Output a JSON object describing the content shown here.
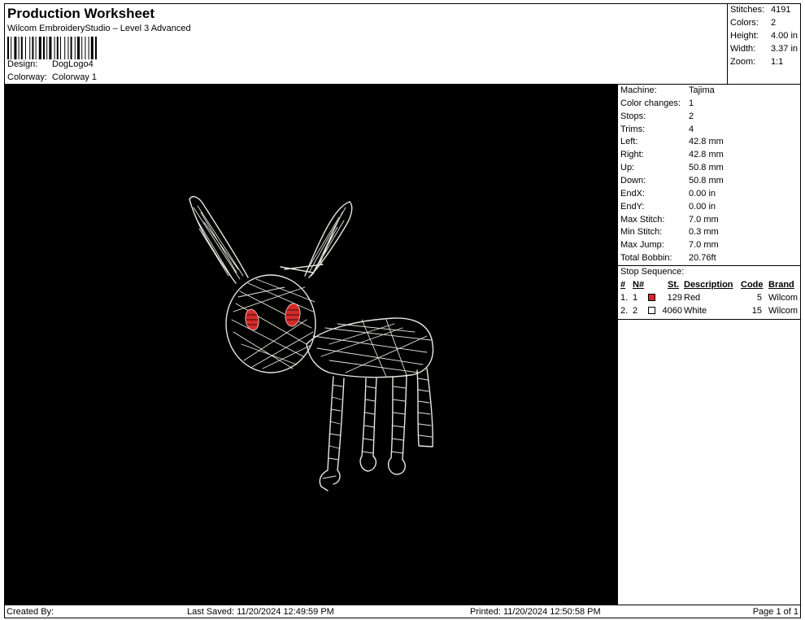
{
  "header": {
    "title": "Production Worksheet",
    "subtitle": "Wilcom EmbroideryStudio – Level 3 Advanced",
    "design_label": "Design:",
    "design_value": "DogLogo4",
    "colorway_label": "Colorway:",
    "colorway_value": "Colorway 1"
  },
  "summary": [
    {
      "label": "Stitches:",
      "value": "4191"
    },
    {
      "label": "Colors:",
      "value": "2"
    },
    {
      "label": "Height:",
      "value": "4.00 in"
    },
    {
      "label": "Width:",
      "value": "3.37 in"
    },
    {
      "label": "Zoom:",
      "value": "1:1"
    }
  ],
  "info": [
    {
      "label": "Machine:",
      "value": "Tajima"
    },
    {
      "label": "Color changes:",
      "value": "1"
    },
    {
      "label": "Stops:",
      "value": "2"
    },
    {
      "label": "Trims:",
      "value": "4"
    },
    {
      "label": "Left:",
      "value": "42.8 mm"
    },
    {
      "label": "Right:",
      "value": "42.8 mm"
    },
    {
      "label": "Up:",
      "value": "50.8 mm"
    },
    {
      "label": "Down:",
      "value": "50.8 mm"
    },
    {
      "label": "EndX:",
      "value": "0.00 in"
    },
    {
      "label": "EndY:",
      "value": "0.00 in"
    },
    {
      "label": "Max Stitch:",
      "value": "7.0 mm"
    },
    {
      "label": "Min Stitch:",
      "value": "0.3 mm"
    },
    {
      "label": "Max Jump:",
      "value": "7.0 mm"
    },
    {
      "label": "Total Bobbin:",
      "value": "20.76ft"
    }
  ],
  "stop_sequence": {
    "title": "Stop Sequence:",
    "columns": {
      "num": "#",
      "needle": "N#",
      "stitches": "St.",
      "description": "Description",
      "code": "Code",
      "brand": "Brand"
    },
    "rows": [
      {
        "num": "1.",
        "needle": "1",
        "swatch": "#d42a2a",
        "stitches": "129",
        "description": "Red",
        "code": "5",
        "brand": "Wilcom"
      },
      {
        "num": "2.",
        "needle": "2",
        "swatch": "#ffffff",
        "stitches": "4060",
        "description": "White",
        "code": "15",
        "brand": "Wilcom"
      }
    ]
  },
  "footer": {
    "created_by": "Created By:",
    "last_saved": "Last Saved: 11/20/2024 12:49:59 PM",
    "printed": "Printed: 11/20/2024 12:50:58 PM",
    "page": "Page 1 of 1"
  },
  "colors": {
    "canvas_background": "#000000",
    "thread_white": "#e8e8e0",
    "thread_red": "#d42a2a"
  }
}
